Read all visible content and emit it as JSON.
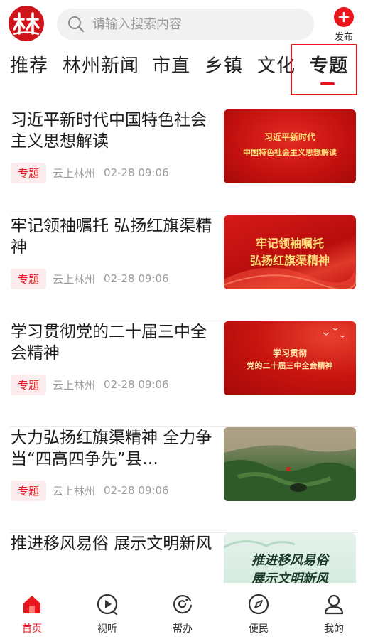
{
  "header": {
    "logo_icon": "linzhou-logo-icon",
    "search_placeholder": "请输入搜索内容",
    "publish_label": "发布"
  },
  "tabs": [
    {
      "label": "推荐",
      "active": false
    },
    {
      "label": "林州新闻",
      "active": false
    },
    {
      "label": "市直",
      "active": false
    },
    {
      "label": "乡镇",
      "active": false
    },
    {
      "label": "文化",
      "active": false
    },
    {
      "label": "专题",
      "active": true
    }
  ],
  "articles": [
    {
      "title": "习近平新时代中国特色社会主义思想解读",
      "tag": "专题",
      "source": "云上林州",
      "time": "02-28 09:06",
      "thumb_lines": [
        "习近平新时代",
        "中国特色社会主义思想解读"
      ]
    },
    {
      "title": "牢记领袖嘱托  弘扬红旗渠精神",
      "tag": "专题",
      "source": "云上林州",
      "time": "02-28 09:06",
      "thumb_lines": [
        "牢记领袖嘱托",
        "弘扬红旗渠精神"
      ]
    },
    {
      "title": "学习贯彻党的二十届三中全会精神",
      "tag": "专题",
      "source": "云上林州",
      "time": "02-28 09:06",
      "thumb_lines": [
        "学习贯彻",
        "党的二十届三中全会精神"
      ]
    },
    {
      "title": "大力弘扬红旗渠精神 全力争当“四高四争先”县…",
      "tag": "专题",
      "source": "云上林州",
      "time": "02-28 09:06",
      "thumb_lines": []
    },
    {
      "title": "推进移风易俗 展示文明新风",
      "tag": "",
      "source": "",
      "time": "",
      "thumb_lines": [
        "推进移风易俗",
        "展示文明新风"
      ]
    }
  ],
  "bottom_nav": [
    {
      "label": "首页",
      "icon": "home-icon",
      "active": true
    },
    {
      "label": "视听",
      "icon": "play-icon",
      "active": false
    },
    {
      "label": "帮办",
      "icon": "help-icon",
      "active": false
    },
    {
      "label": "便民",
      "icon": "compass-icon",
      "active": false
    },
    {
      "label": "我的",
      "icon": "user-icon",
      "active": false
    }
  ],
  "colors": {
    "accent": "#e8161c",
    "badge_bg": "#fdeced",
    "meta_text": "#9a9a9a"
  }
}
